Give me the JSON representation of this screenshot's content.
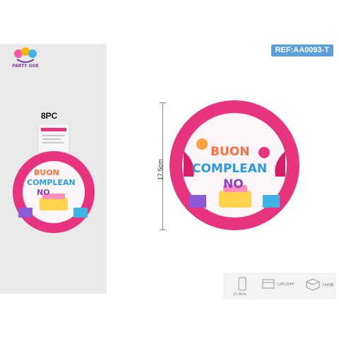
{
  "brand": {
    "logo_text": "PARTY GOE"
  },
  "product": {
    "pieces_label": "8PC",
    "reference": "REF:AA0093-T",
    "diameter": "17.5cm",
    "plate_text_line1": "BUON",
    "plate_text_line2": "COMPLEAN",
    "plate_text_line3": "NO",
    "package_title": "8PC"
  },
  "specs": {
    "size_small": "22.8cm",
    "pack": "12PC/OPP",
    "carton": "144/箱"
  },
  "colors": {
    "plate_rim": "#e8337f",
    "plate_center": "#fdf6f9",
    "ref_badge": "#5aa0dc",
    "left_panel": "#e9e9e9"
  }
}
